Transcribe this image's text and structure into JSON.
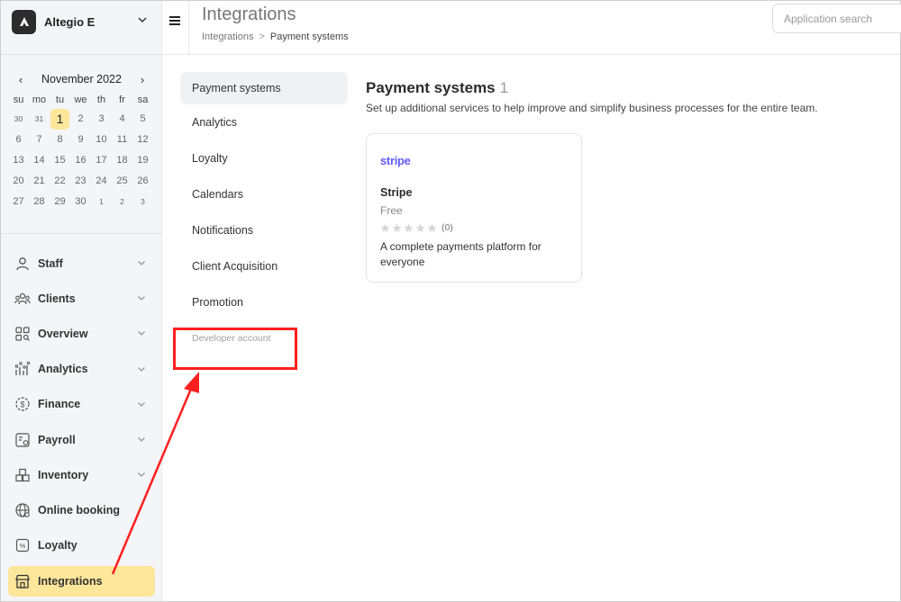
{
  "company": {
    "name": "Altegio E"
  },
  "calendar": {
    "month_label": "November 2022",
    "dows": [
      "su",
      "mo",
      "tu",
      "we",
      "th",
      "fr",
      "sa"
    ],
    "days": [
      {
        "d": "30",
        "other": true
      },
      {
        "d": "31",
        "other": true
      },
      {
        "d": "1",
        "today": true
      },
      {
        "d": "2"
      },
      {
        "d": "3"
      },
      {
        "d": "4"
      },
      {
        "d": "5"
      },
      {
        "d": "6"
      },
      {
        "d": "7"
      },
      {
        "d": "8"
      },
      {
        "d": "9"
      },
      {
        "d": "10"
      },
      {
        "d": "11"
      },
      {
        "d": "12"
      },
      {
        "d": "13"
      },
      {
        "d": "14"
      },
      {
        "d": "15"
      },
      {
        "d": "16"
      },
      {
        "d": "17"
      },
      {
        "d": "18"
      },
      {
        "d": "19"
      },
      {
        "d": "20"
      },
      {
        "d": "21"
      },
      {
        "d": "22"
      },
      {
        "d": "23"
      },
      {
        "d": "24"
      },
      {
        "d": "25"
      },
      {
        "d": "26"
      },
      {
        "d": "27"
      },
      {
        "d": "28"
      },
      {
        "d": "29"
      },
      {
        "d": "30"
      },
      {
        "d": "1",
        "other": true
      },
      {
        "d": "2",
        "other": true
      },
      {
        "d": "3",
        "other": true
      }
    ]
  },
  "sidebar": {
    "items": [
      {
        "label": "Staff",
        "icon": "user-icon",
        "chevron": true
      },
      {
        "label": "Clients",
        "icon": "clients-icon",
        "chevron": true
      },
      {
        "label": "Overview",
        "icon": "overview-icon",
        "chevron": true
      },
      {
        "label": "Analytics",
        "icon": "analytics-icon",
        "chevron": true
      },
      {
        "label": "Finance",
        "icon": "finance-icon",
        "chevron": true
      },
      {
        "label": "Payroll",
        "icon": "payroll-icon",
        "chevron": true
      },
      {
        "label": "Inventory",
        "icon": "inventory-icon",
        "chevron": true
      },
      {
        "label": "Online booking",
        "icon": "globe-icon",
        "chevron": false
      },
      {
        "label": "Loyalty",
        "icon": "loyalty-icon",
        "chevron": false
      },
      {
        "label": "Integrations",
        "icon": "store-icon",
        "chevron": false,
        "active": true
      }
    ]
  },
  "header": {
    "title": "Integrations",
    "breadcrumb": [
      "Integrations",
      "Payment systems"
    ],
    "search_placeholder": "Application search"
  },
  "categories": [
    {
      "label": "Payment systems",
      "active": true
    },
    {
      "label": "Analytics"
    },
    {
      "label": "Loyalty"
    },
    {
      "label": "Calendars"
    },
    {
      "label": "Notifications"
    },
    {
      "label": "Client Acquisition"
    },
    {
      "label": "Promotion"
    },
    {
      "label": "Developer account",
      "muted": true
    }
  ],
  "content": {
    "title": "Payment systems",
    "count": "1",
    "subtitle": "Set up additional services to help improve and simplify business processes for the entire team."
  },
  "card": {
    "brand": "stripe",
    "name": "Stripe",
    "price": "Free",
    "rating_count": "(0)",
    "stars": 0,
    "description": "A complete payments platform for everyone"
  },
  "colors": {
    "accent": "#fce79b",
    "annotation": "#ff1f1f",
    "stripe": "#635bff"
  }
}
